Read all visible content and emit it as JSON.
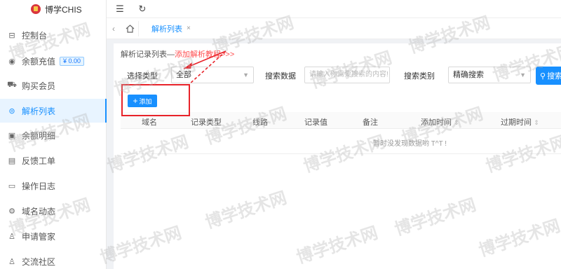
{
  "brand": {
    "name": "博学CHIS"
  },
  "sidebar": {
    "items": [
      {
        "label": "控制台",
        "icon": "dashboard-icon"
      },
      {
        "label": "余额充值",
        "icon": "wallet-icon",
        "badge": "¥ 0.00"
      },
      {
        "label": "购买会员",
        "icon": "cart-icon"
      },
      {
        "label": "解析列表",
        "icon": "list-icon",
        "active": true
      },
      {
        "label": "余额明细",
        "icon": "ledger-icon"
      },
      {
        "label": "反馈工单",
        "icon": "ticket-icon"
      },
      {
        "label": "操作日志",
        "icon": "log-icon"
      },
      {
        "label": "域名动态",
        "icon": "domain-icon"
      },
      {
        "label": "申请管家",
        "icon": "user-icon"
      },
      {
        "label": "交流社区",
        "icon": "community-icon"
      }
    ]
  },
  "topbar": {
    "menu_icon": "☰",
    "refresh_icon": "↻"
  },
  "tabs": {
    "items": [
      {
        "label": "解析列表",
        "closable": true
      }
    ]
  },
  "panel": {
    "title": "解析记录列表—",
    "tutorial_link": "添加解析教程>>>"
  },
  "search": {
    "type_label": "选择类型",
    "type_value": "全部",
    "data_label": "搜索数据",
    "data_placeholder": "请输入你需要搜索的内容!",
    "category_label": "搜索类别",
    "category_value": "精确搜索",
    "button_label": "搜索"
  },
  "toolbar": {
    "add_label": "添加"
  },
  "table": {
    "columns": [
      "域名",
      "记录类型",
      "线路",
      "记录值",
      "备注",
      "添加时间",
      "过期时间"
    ],
    "empty_text": "暂时没发现数据哟 T^T !"
  },
  "watermark": {
    "text": "博学技术网"
  },
  "colors": {
    "primary": "#1890ff",
    "annotation": "#e8232a"
  }
}
